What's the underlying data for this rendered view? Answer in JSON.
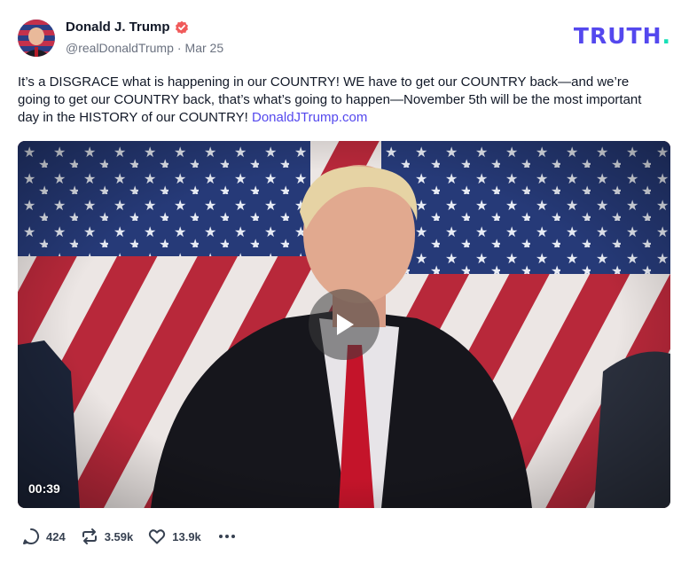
{
  "author": {
    "display_name": "Donald J. Trump",
    "handle": "@realDonaldTrump",
    "date": "Mar 25",
    "separator": "·"
  },
  "brand": {
    "logo_text": "TRUTH",
    "logo_dot": ".",
    "accent_color": "#5448ee",
    "dot_color": "#17e0b7"
  },
  "post": {
    "body": "It’s a DISGRACE what is happening in our COUNTRY! WE have to get our COUNTRY back—and we’re going to get our COUNTRY back, that’s what’s going to happen—November 5th will be the most important day in the HISTORY of our COUNTRY! ",
    "link_text": "DonaldJTrump.com"
  },
  "video": {
    "duration": "00:39",
    "play_icon": "play-icon"
  },
  "actions": {
    "replies": "424",
    "retruths": "3.59k",
    "likes": "13.9k"
  },
  "icons": {
    "verified": "verified-badge-icon",
    "reply": "reply-icon",
    "retruth": "retruth-icon",
    "like": "heart-icon",
    "more": "more-icon"
  },
  "colors": {
    "verified_badge": "#f05a5a",
    "text_muted": "#6b7280"
  }
}
